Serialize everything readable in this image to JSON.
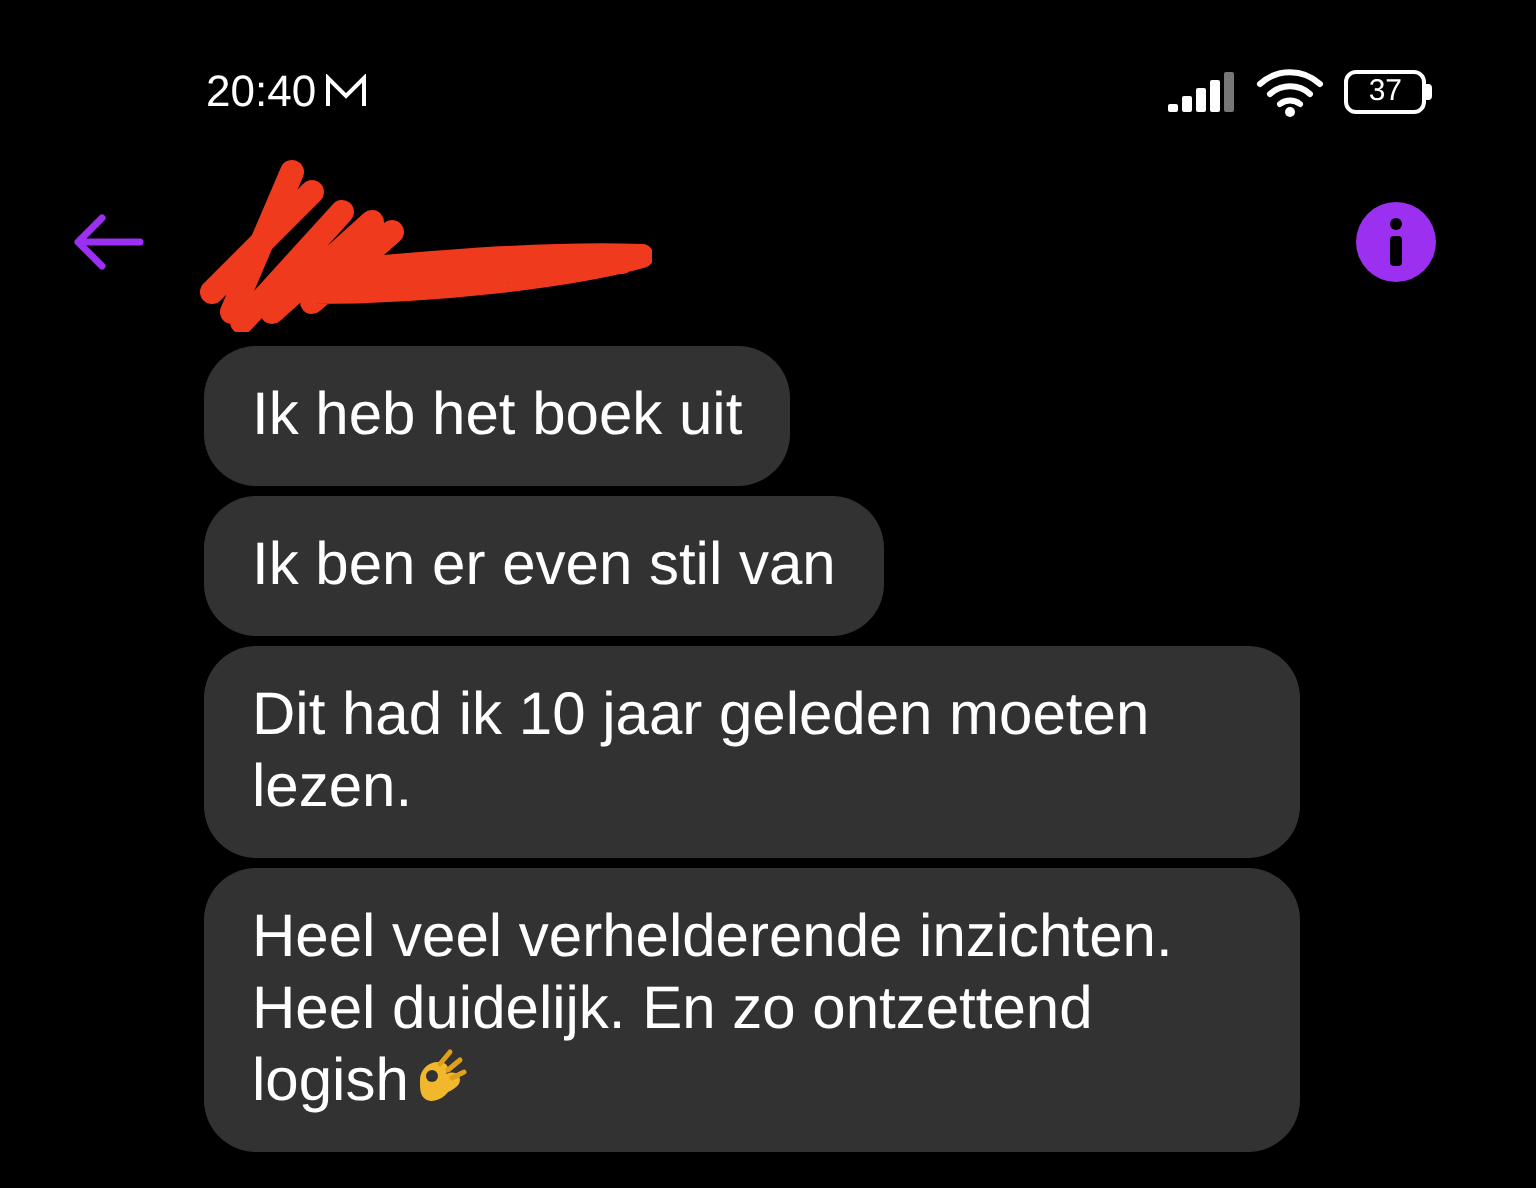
{
  "status_bar": {
    "time": "20:40",
    "battery": "37"
  },
  "header": {
    "contact_redacted": true
  },
  "messages": [
    {
      "text": "Ik heb het boek uit",
      "emoji": false
    },
    {
      "text": "Ik ben er even stil van",
      "emoji": false
    },
    {
      "text": "Dit had ik 10 jaar geleden moeten lezen.",
      "emoji": false
    },
    {
      "text": "Heel veel verhelderende inzichten. Heel duidelijk. En zo ontzettend logish",
      "emoji": true
    }
  ]
}
